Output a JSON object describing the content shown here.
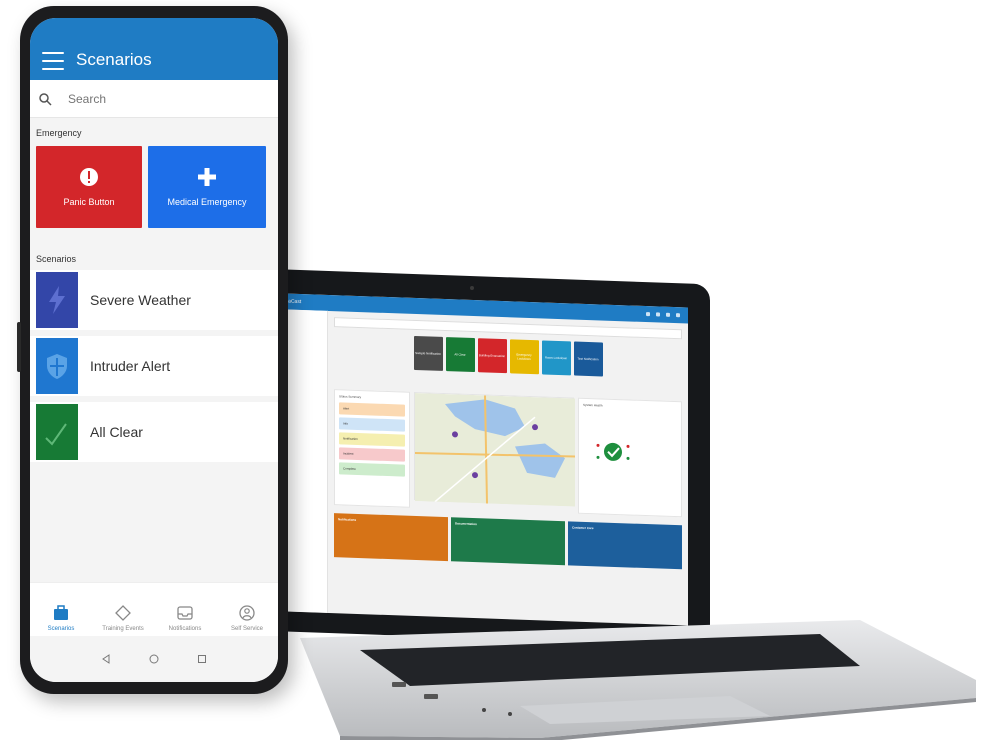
{
  "phone": {
    "app_title": "Scenarios",
    "search_placeholder": "Search",
    "emergency_label": "Emergency",
    "emergency_tiles": [
      {
        "label": "Panic Button",
        "color": "#d3262a",
        "icon": "alert-icon"
      },
      {
        "label": "Medical Emergency",
        "color": "#1d6ee8",
        "icon": "plus-icon"
      }
    ],
    "scenarios_label": "Scenarios",
    "scenarios": [
      {
        "label": "Severe Weather",
        "color": "#3346a8",
        "icon": "lightning-icon"
      },
      {
        "label": "Intruder Alert",
        "color": "#1f77d0",
        "icon": "shield-icon"
      },
      {
        "label": "All Clear",
        "color": "#177a35",
        "icon": "check-icon"
      }
    ],
    "bottom_nav": [
      {
        "label": "Scenarios",
        "icon": "briefcase-icon",
        "active": true
      },
      {
        "label": "Training Events",
        "icon": "diamond-icon",
        "active": false
      },
      {
        "label": "Notifications",
        "icon": "inbox-icon",
        "active": false
      },
      {
        "label": "Self Service",
        "icon": "person-icon",
        "active": false
      }
    ]
  },
  "laptop": {
    "brand": "InformaCast",
    "scenario_buttons": [
      {
        "label": "Sample Notification",
        "color": "#4a4a4a"
      },
      {
        "label": "All Clear",
        "color": "#177a35"
      },
      {
        "label": "Building Evacuation",
        "color": "#d3262a"
      },
      {
        "label": "Emergency Lockdown",
        "color": "#e6b800"
      },
      {
        "label": "Room Lockdown",
        "color": "#2196c8"
      },
      {
        "label": "Test Notification",
        "color": "#1a5a9a"
      }
    ],
    "status_widget_title": "Status Summary",
    "status_items": [
      {
        "label": "Alert",
        "color": "#fbd9b2"
      },
      {
        "label": "Info",
        "color": "#cfe4f7"
      },
      {
        "label": "Notification",
        "color": "#f5efb0"
      },
      {
        "label": "Incident",
        "color": "#f7c9cb"
      },
      {
        "label": "Complete",
        "color": "#cdeccc"
      }
    ],
    "system_widget_title": "System Health",
    "info_cards": [
      {
        "title": "Notifications",
        "color": "#d67317"
      },
      {
        "title": "Documentation",
        "color": "#1e7a4a"
      },
      {
        "title": "Customer Care",
        "color": "#1d5f9c"
      }
    ]
  }
}
